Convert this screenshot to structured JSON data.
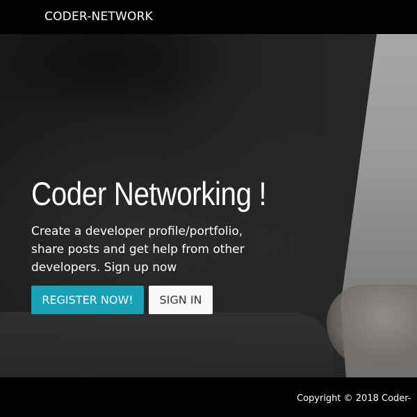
{
  "navbar": {
    "brand": "CODER-NETWORK"
  },
  "hero": {
    "title": "Coder Networking !",
    "lead": "Create a developer profile/portfolio, share posts and get help from other developers. Sign up now",
    "buttons": {
      "register": "REGISTER NOW!",
      "signin": "SIGN IN"
    }
  },
  "footer": {
    "copyright": "Copyright © 2018 Coder-"
  },
  "colors": {
    "primary_button": "#17a2b8",
    "light_button": "#f8f9fa",
    "navbar_bg": "#000000",
    "footer_bg": "#000000"
  }
}
